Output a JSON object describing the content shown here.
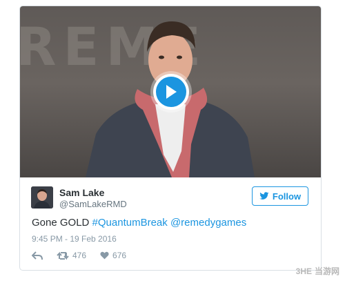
{
  "video": {
    "background_text": "REME",
    "play_icon": "play-icon"
  },
  "tweet": {
    "author_name": "Sam Lake",
    "author_handle": "@SamLakeRMD",
    "follow_label": "Follow",
    "text_plain": "Gone GOLD ",
    "hashtag": "#QuantumBreak",
    "mention": "@remedygames",
    "timestamp": "9:45 PM - 19 Feb 2016",
    "retweets": "476",
    "likes": "676"
  },
  "icons": {
    "reply": "reply-icon",
    "retweet": "retweet-icon",
    "like": "heart-icon",
    "bird": "twitter-bird-icon"
  },
  "watermark": {
    "logo_text": "3HE",
    "site_text": "当游网"
  },
  "colors": {
    "accent": "#1b95e0",
    "text": "#292f33",
    "muted": "#8899a6"
  }
}
